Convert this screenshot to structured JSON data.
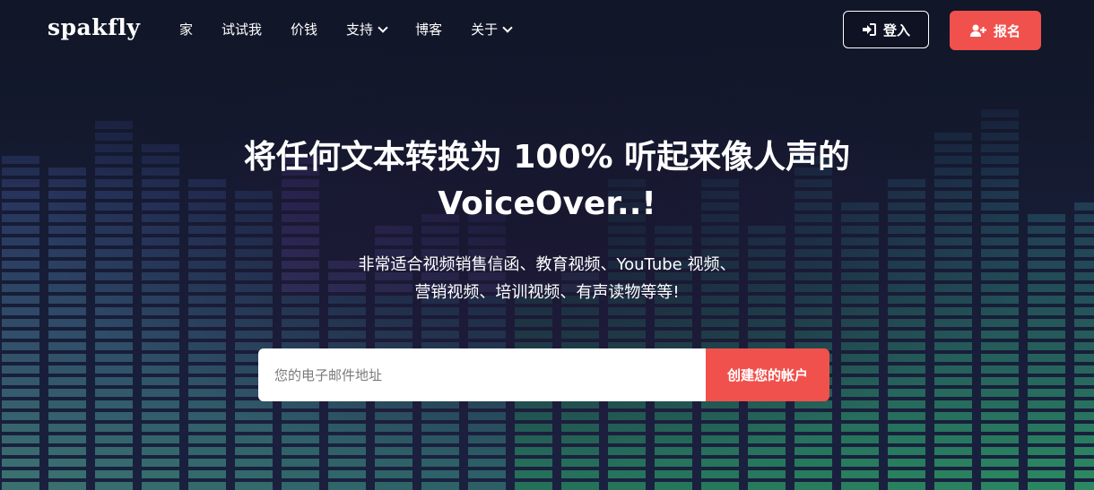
{
  "brand": {
    "logo_text": "spakfly"
  },
  "nav": {
    "items": [
      {
        "label": "家",
        "has_dropdown": false
      },
      {
        "label": "试试我",
        "has_dropdown": false
      },
      {
        "label": "价钱",
        "has_dropdown": false
      },
      {
        "label": "支持",
        "has_dropdown": true
      },
      {
        "label": "博客",
        "has_dropdown": false
      },
      {
        "label": "关于",
        "has_dropdown": true
      }
    ],
    "login_label": "登入",
    "signup_label": "报名"
  },
  "hero": {
    "title_line1": "将任何文本转换为 100% 听起来像人声的",
    "title_line2": "VoiceOver..!",
    "subtitle_line1": "非常适合视频销售信函、教育视频、YouTube 视频、",
    "subtitle_line2": "营销视频、培训视频、有声读物等等!",
    "email_placeholder": "您的电子邮件地址",
    "cta_label": "创建您的帐户"
  },
  "colors": {
    "accent": "#f0514d",
    "background": "#12172b",
    "text": "#ffffff"
  }
}
